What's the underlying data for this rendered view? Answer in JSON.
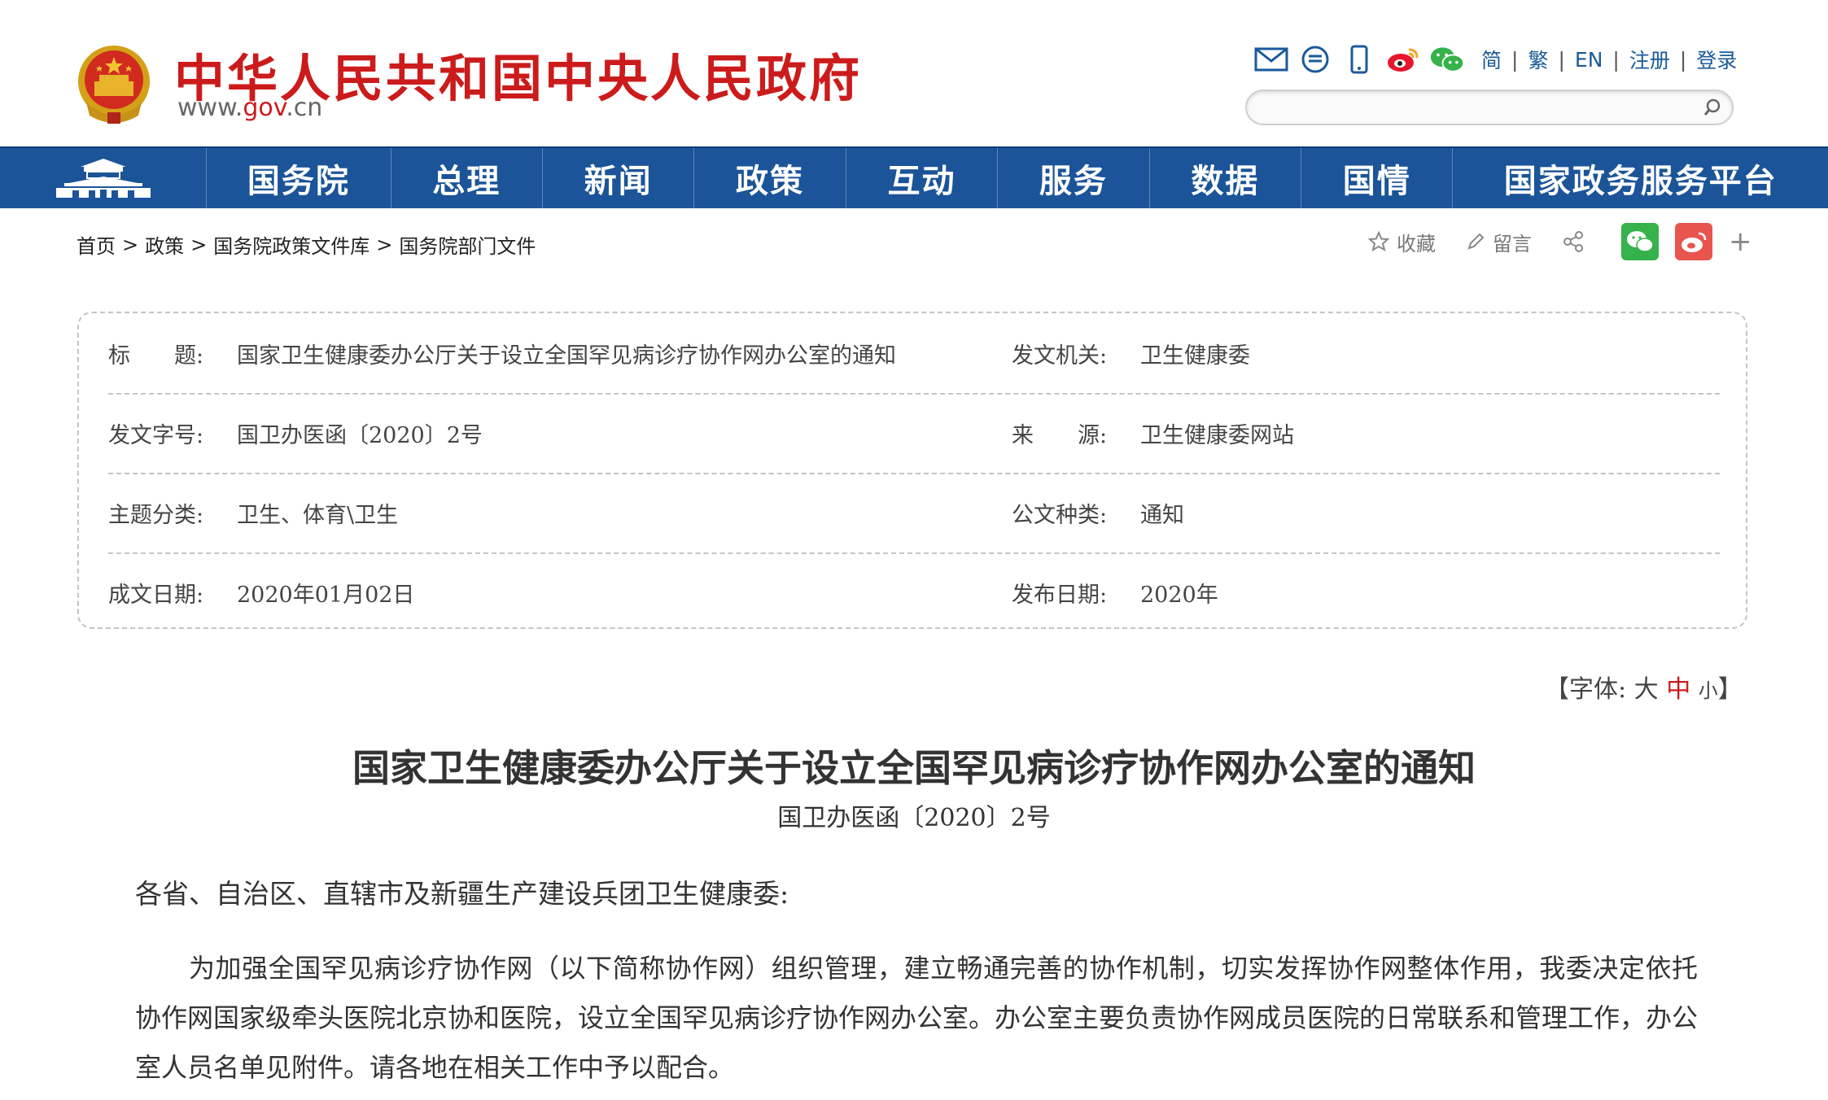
{
  "header": {
    "site_title": "中华人民共和国中央人民政府",
    "site_url_prefix": "www.",
    "site_url_em": "gov",
    "site_url_suffix": ".cn",
    "icons": [
      "mail-icon",
      "message-icon",
      "mobile-icon",
      "weibo-icon",
      "wechat-icon"
    ],
    "links": [
      "简",
      "繁",
      "EN",
      "注册",
      "登录"
    ],
    "search": {
      "value": "",
      "placeholder": ""
    }
  },
  "nav": {
    "items": [
      "国务院",
      "总理",
      "新闻",
      "政策",
      "互动",
      "服务",
      "数据",
      "国情",
      "国家政务服务平台"
    ]
  },
  "breadcrumb": [
    "首页",
    "政策",
    "国务院政策文件库",
    "国务院部门文件"
  ],
  "breadcrumb_sep": ">",
  "share": {
    "favorite": "收藏",
    "comment": "留言",
    "more": "+"
  },
  "info": {
    "title_label": "标　　题:",
    "title_value": "国家卫生健康委办公厅关于设立全国罕见病诊疗协作网办公室的通知",
    "issuer_label": "发文机关:",
    "issuer_value": "卫生健康委",
    "docno_label": "发文字号:",
    "docno_value": "国卫办医函〔2020〕2号",
    "source_label": "来　　源:",
    "source_value": "卫生健康委网站",
    "category_label": "主题分类:",
    "category_value": "卫生、体育\\卫生",
    "type_label": "公文种类:",
    "type_value": "通知",
    "date_label": "成文日期:",
    "date_value": "2020年01月02日",
    "pubdate_label": "发布日期:",
    "pubdate_value": "2020年"
  },
  "font_size_ctrl": {
    "open": "【字体:",
    "large": "大",
    "medium": "中",
    "small": "小",
    "close": "】"
  },
  "article": {
    "title": "国家卫生健康委办公厅关于设立全国罕见病诊疗协作网办公室的通知",
    "doc_no": "国卫办医函〔2020〕2号",
    "addressee": "各省、自治区、直辖市及新疆生产建设兵团卫生健康委:",
    "paragraph": "为加强全国罕见病诊疗协作网（以下简称协作网）组织管理，建立畅通完善的协作机制，切实发挥协作网整体作用，我委决定依托协作网国家级牵头医院北京协和医院，设立全国罕见病诊疗协作网办公室。办公室主要负责协作网成员医院的日常联系和管理工作，办公室人员名单见附件。请各地在相关工作中予以配合。"
  },
  "colors": {
    "brand_red": "#cc1b1b",
    "nav_blue": "#1b5498",
    "link_blue": "#1a5a99"
  }
}
